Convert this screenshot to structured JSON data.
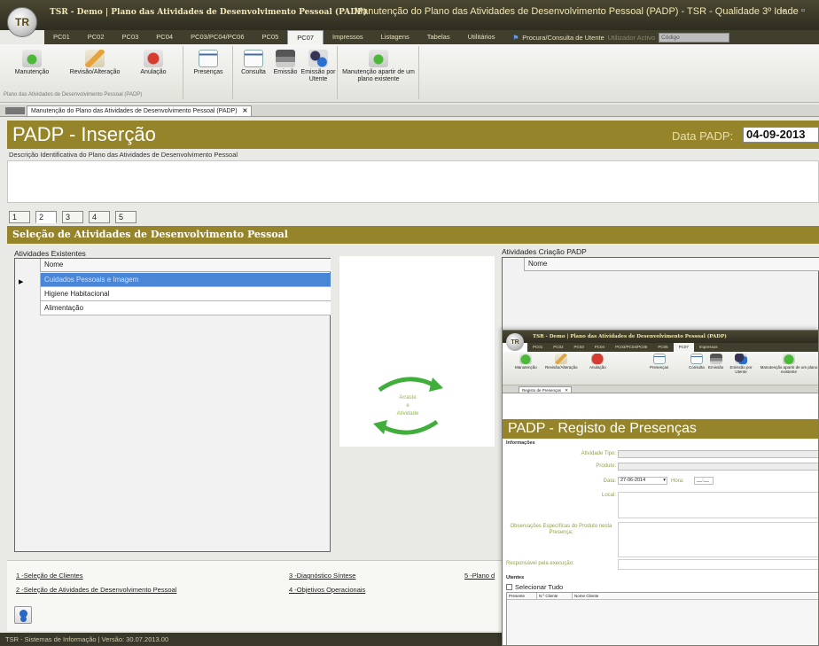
{
  "window": {
    "logo": "TR",
    "title_left": "TSR - Demo  |  Plano das Atividades de Desenvolvimento Pessoal (PADP)",
    "title_right": "Manutenção do Plano das Atividades de Desenvolvimento Pessoal (PADP) - TSR - Qualidade 3º Idade",
    "min": "–",
    "max": "▫"
  },
  "ribbon_tabs": [
    "PC01",
    "PC02",
    "PC03",
    "PC04",
    "PC03/PC04/PC06",
    "PC05",
    "PC07",
    "Impressos",
    "Listagens",
    "Tabelas",
    "Utilitários"
  ],
  "active_tab": "PC07",
  "search": {
    "label": "Procura/Consulta de Utente",
    "scope": "Utilizador Activo",
    "placeholder": "Código"
  },
  "ribbon": {
    "btn_manutencao": "Manutenção",
    "btn_revisao": "Revisão/Alteração",
    "btn_anulacao": "Anulação",
    "btn_presencas": "Presenças",
    "btn_consulta": "Consulta",
    "btn_emissao": "Emissão",
    "btn_emissao_utente": "Emissão por Utente",
    "btn_manutencao_plano": "Manutenção apartir de um plano existente",
    "group_name": "Plano das Atividades de Desenvolvimento Pessoal (PADP)"
  },
  "doc_tab": "Manutenção do Plano das Atividades de Desenvolvimento Pessoal (PADP)",
  "doc_tab_close": "✕",
  "header": {
    "title": "PADP - Inserção",
    "date_label": "Data PADP:",
    "date_value": "04-09-2013"
  },
  "description_label": "Descrição Identificativa do Plano das Atividades de Desenvolvimento Pessoal",
  "step_tabs": [
    "1",
    "2",
    "3",
    "4",
    "5"
  ],
  "active_step": "2",
  "section_title": "Seleção de Atividades de Desenvolvimento Pessoal",
  "left_grid": {
    "label": "Atividades Existentes",
    "column": "Nome",
    "rows": [
      "Cuidados Pessoais e Imagem",
      "Higiene Habitacional",
      "Alimentação"
    ],
    "selected_row": 0
  },
  "right_grid": {
    "label": "Atividades Criação PADP",
    "column": "Nome"
  },
  "transfer": {
    "line1": "Arraste",
    "line2": "e",
    "line3": "Atividade"
  },
  "bottom_links": {
    "l1": "1 -Seleção de Clientes",
    "l2": "2 -Seleção de Atividades de Desenvolvimento Pessoal",
    "l3": "3 -Diagnóstico Síntese",
    "l4": "4 -Objetivos Operacionais",
    "l5": "5 -Plano d"
  },
  "status_bar": "TSR - Sistemas de Informação  | Versão: 30.07.2013.00",
  "overlay": {
    "title": "TSR - Demo  |  Plano das Atividades de Desenvolvimento Pessoal (PADP)",
    "tabs": [
      "PC01",
      "PC02",
      "PC03",
      "PC04",
      "PC03/PC04/PC06",
      "PC05",
      "PC07",
      "Impressos"
    ],
    "doc_tab": "Registo de Presenças",
    "header": "PADP - Registo de Presenças",
    "info_label": "Informações",
    "atividade_label": "Atividade Tipo:",
    "produto_label": "Produto:",
    "data_label": "Data:",
    "data_value": "27-06-2014",
    "hora_label": "Hora:",
    "hora_value": "__:__",
    "local_label": "Local:",
    "obs_label": "Observações Específicas do Produto nesta Presença:",
    "resp_label": "Responsável pela execução:",
    "utentes_label": "Utentes",
    "select_all": "Selecionar Tudo",
    "col_presente": "Presente",
    "col_ncliente": "N.º Cliente",
    "col_nome": "Nome Cliente"
  },
  "colors": {
    "accent": "#96842a",
    "titlebar": "#3a382a",
    "selection": "#4a86d6"
  }
}
